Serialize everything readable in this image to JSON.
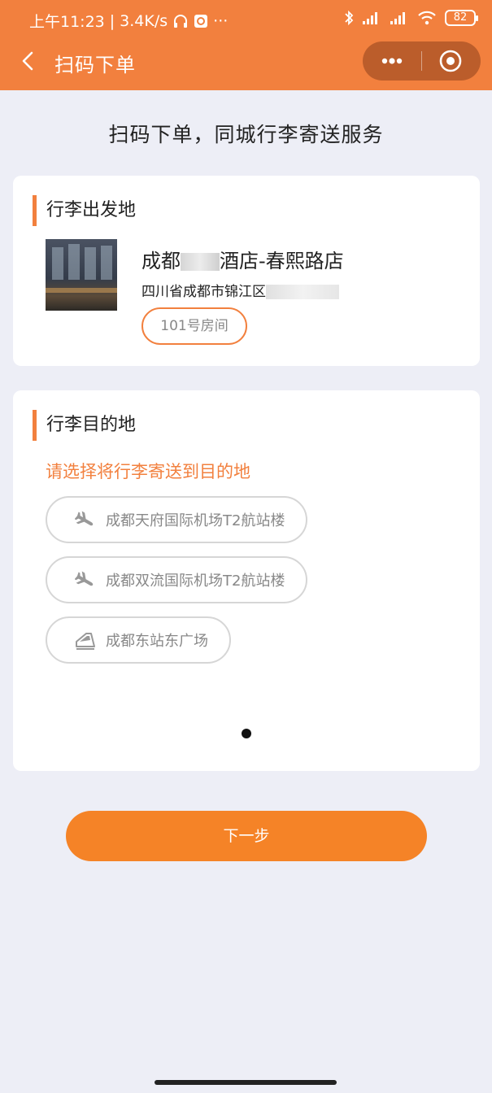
{
  "status_bar": {
    "time": "上午11:23",
    "speed": "3.4K/s",
    "battery": "82"
  },
  "nav": {
    "title": "扫码下单"
  },
  "headline": "扫码下单，同城行李寄送服务",
  "origin": {
    "section_title": "行李出发地",
    "hotel_name_prefix": "成都",
    "hotel_name_suffix": "酒店-春熙路店",
    "hotel_address": "四川省成都市锦江区",
    "room": "101号房间"
  },
  "destination": {
    "section_title": "行李目的地",
    "hint": "请选择将行李寄送到目的地",
    "options": [
      {
        "label": "成都天府国际机场T2航站楼",
        "icon": "airplane-icon"
      },
      {
        "label": "成都双流国际机场T2航站楼",
        "icon": "airplane-icon"
      },
      {
        "label": "成都东站东广场",
        "icon": "train-icon"
      }
    ]
  },
  "next_button": "下一步",
  "colors": {
    "accent": "#f2803e",
    "button": "#f58327",
    "background": "#edeef6"
  }
}
